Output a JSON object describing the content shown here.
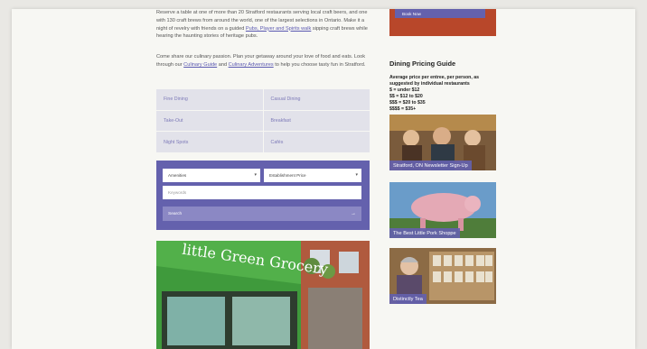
{
  "intro": {
    "p1a": "Reserve a table at one of more than 20 Stratford restaurants serving local craft beers, and one with 130 craft brews from around the world, one of the largest selections in Ontario. Make it a night of revelry with friends on a guided ",
    "p1_link": "Pubs, Player and Spirits walk",
    "p1b": " sipping craft brews while hearing the haunting stories of heritage pubs.",
    "p2a": "Come share our culinary passion. Plan your getaway around your love of food and eats. Look through our ",
    "p2_link1": "Culinary Guide",
    "p2_and": " and ",
    "p2_link2": "Culinary Adventures",
    "p2b": " to help you choose tasty fun in Stratford."
  },
  "categories": [
    "Fine Dining",
    "Casual Dining",
    "Take-Out",
    "Breakfast",
    "Night Spots",
    "Cafés"
  ],
  "search": {
    "amenities": "Amenities",
    "price": "Establishment Price",
    "keywords_placeholder": "Keywords",
    "button": "Search",
    "button_arrow": "→"
  },
  "store_sign": "little Green Grocery",
  "sidebar": {
    "book_button": "Book Now",
    "pricing_title": "Dining Pricing Guide",
    "pricing_intro": "Average price per entree, per person, as suggested by individual restaurants",
    "pricing_tiers": [
      "$ = under $12",
      "$$ = $12 to $20",
      "$$$ = $20 to $35",
      "$$$$ = $35+"
    ],
    "cards": [
      "Stratford, ON Newsletter Sign-Up",
      "The Best Little Pork Shoppe",
      "Distinctly Tea"
    ]
  }
}
